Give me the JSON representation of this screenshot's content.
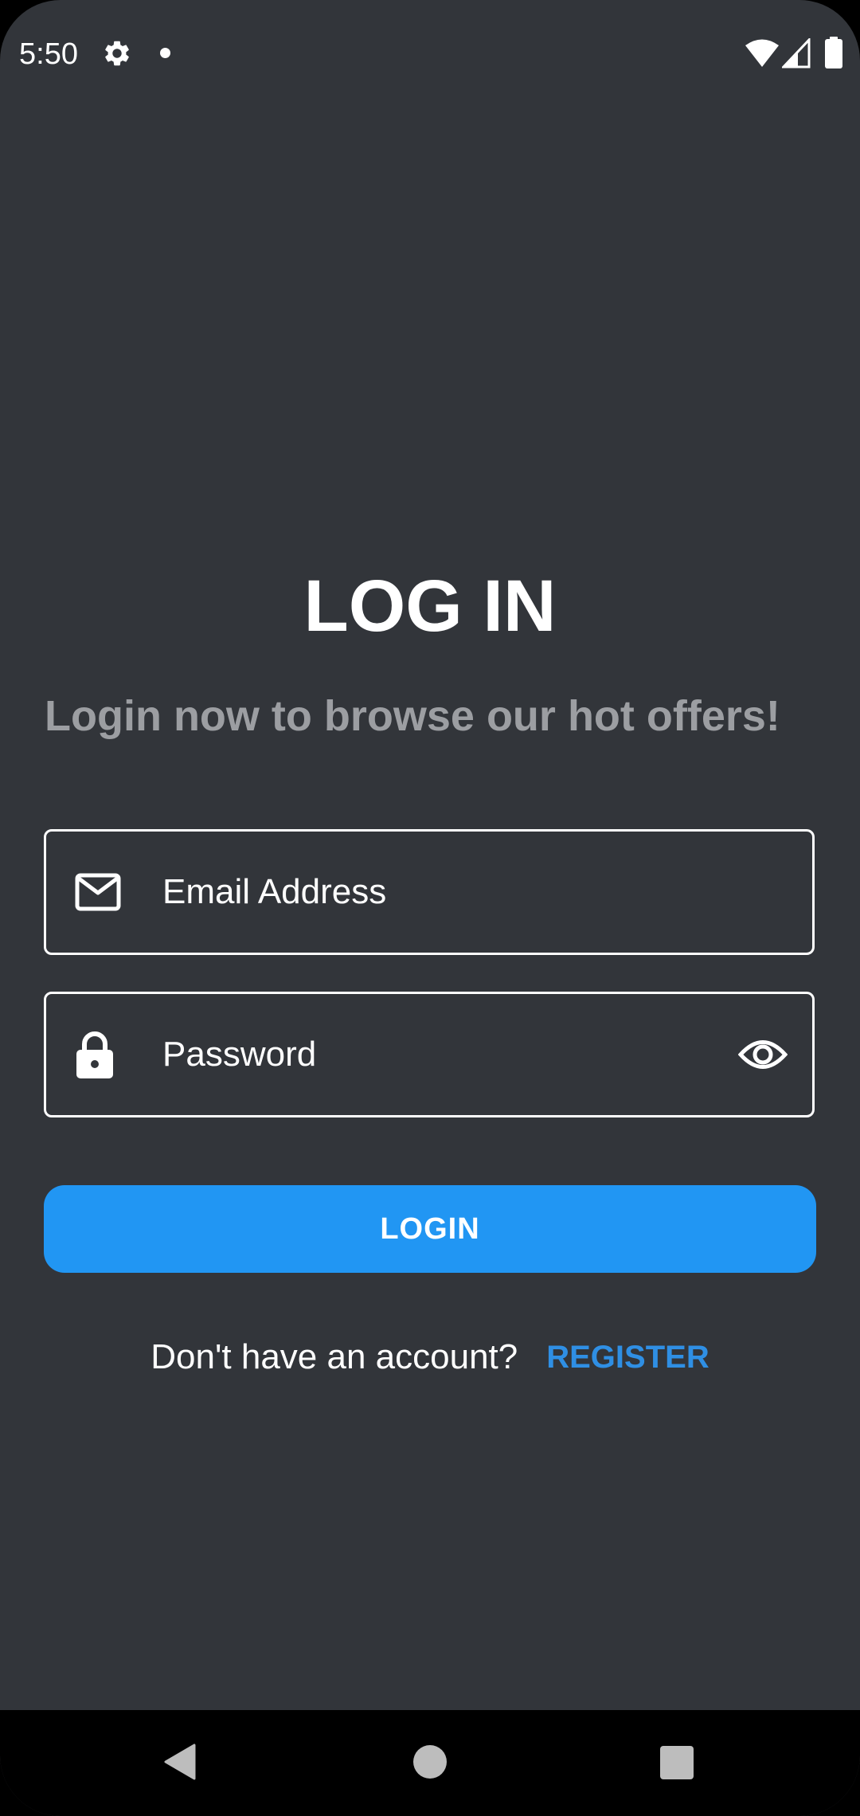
{
  "status_bar": {
    "time": "5:50",
    "icons": [
      "gear-icon",
      "notification-dot",
      "wifi-icon",
      "cell-signal-icon",
      "battery-icon"
    ]
  },
  "login": {
    "title": "LOG IN",
    "subtitle": "Login now to browse our hot offers!",
    "email_placeholder": "Email Address",
    "password_placeholder": "Password",
    "login_button": "LOGIN",
    "register_prompt": "Don't have an account?",
    "register_link": "REGISTER"
  },
  "nav_bar": {
    "buttons": [
      "back",
      "home",
      "recents"
    ]
  },
  "colors": {
    "background": "#32353a",
    "accent": "#2196f3",
    "subtitle": "#9c9ea2",
    "nav_bar": "#000000"
  }
}
